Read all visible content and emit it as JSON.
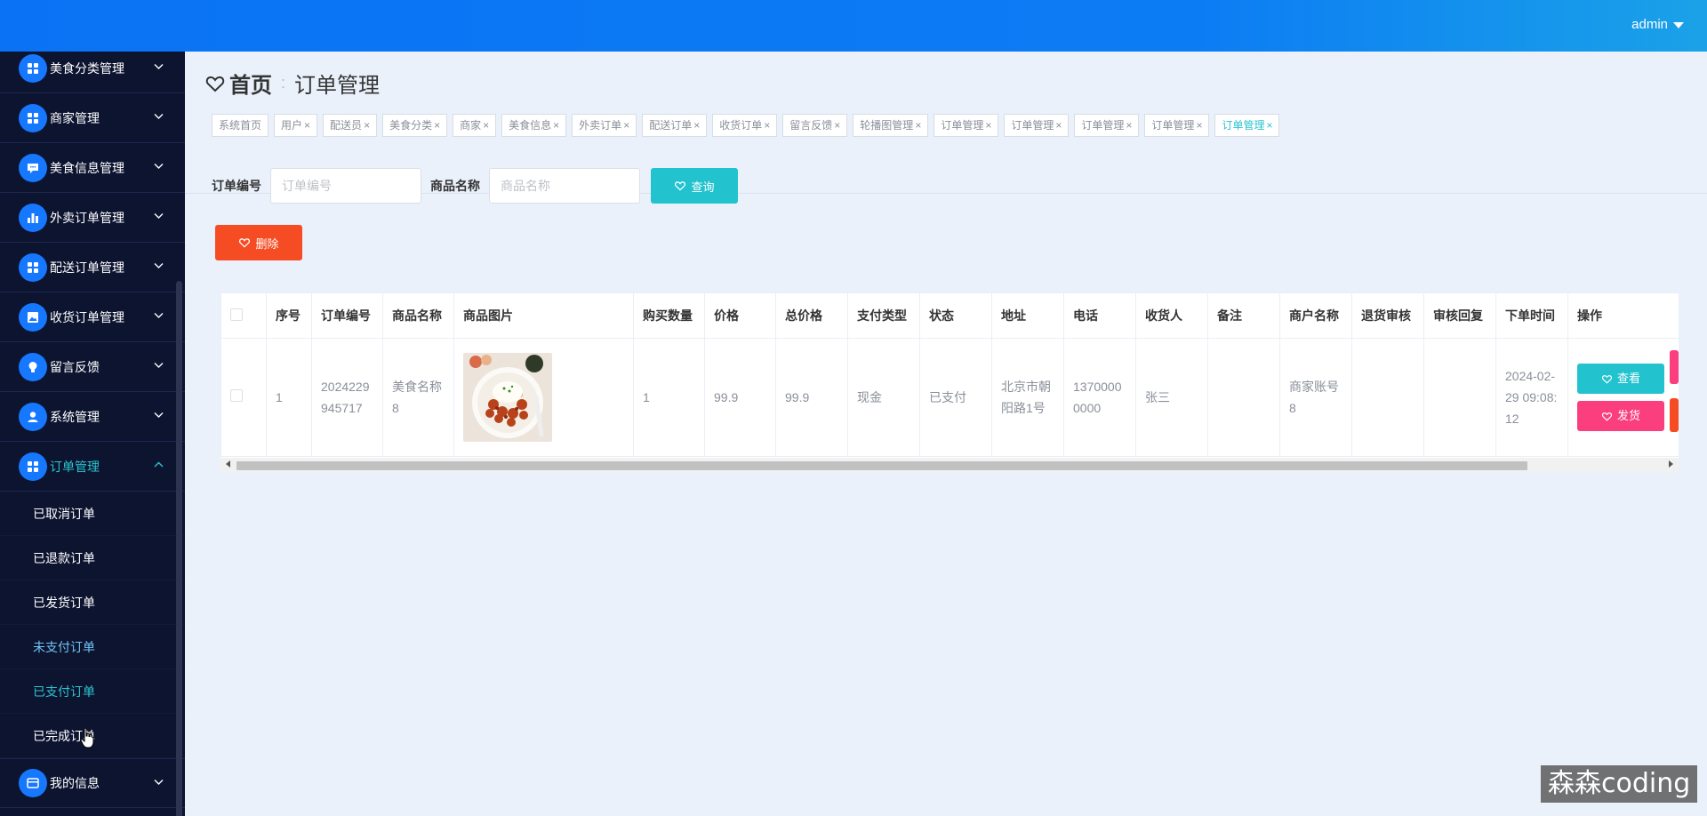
{
  "header": {
    "user": "admin"
  },
  "sidebar": {
    "items": [
      {
        "label": "美食分类管理",
        "icon": "grid-icon"
      },
      {
        "label": "商家管理",
        "icon": "grid-icon"
      },
      {
        "label": "美食信息管理",
        "icon": "chat-icon"
      },
      {
        "label": "外卖订单管理",
        "icon": "bar-chart-icon"
      },
      {
        "label": "配送订单管理",
        "icon": "grid-icon"
      },
      {
        "label": "收货订单管理",
        "icon": "picture-icon"
      },
      {
        "label": "留言反馈",
        "icon": "bulb-icon"
      },
      {
        "label": "系统管理",
        "icon": "user-icon"
      },
      {
        "label": "订单管理",
        "icon": "grid-icon",
        "expanded": true
      }
    ],
    "submenu": [
      "已取消订单",
      "已退款订单",
      "已发货订单",
      "未支付订单",
      "已支付订单",
      "已完成订单"
    ],
    "last_item": {
      "label": "我的信息",
      "icon": "card-icon"
    }
  },
  "breadcrumb": {
    "home": "首页",
    "separator": ":",
    "current": "订单管理"
  },
  "tags": [
    {
      "label": "系统首页",
      "closable": false
    },
    {
      "label": "用户",
      "closable": true
    },
    {
      "label": "配送员",
      "closable": true
    },
    {
      "label": "美食分类",
      "closable": true
    },
    {
      "label": "商家",
      "closable": true
    },
    {
      "label": "美食信息",
      "closable": true
    },
    {
      "label": "外卖订单",
      "closable": true
    },
    {
      "label": "配送订单",
      "closable": true
    },
    {
      "label": "收货订单",
      "closable": true
    },
    {
      "label": "留言反馈",
      "closable": true
    },
    {
      "label": "轮播图管理",
      "closable": true
    },
    {
      "label": "订单管理",
      "closable": true
    },
    {
      "label": "订单管理",
      "closable": true
    },
    {
      "label": "订单管理",
      "closable": true
    },
    {
      "label": "订单管理",
      "closable": true
    },
    {
      "label": "订单管理",
      "closable": true,
      "active": true
    }
  ],
  "search": {
    "order_no_label": "订单编号",
    "order_no_placeholder": "订单编号",
    "product_label": "商品名称",
    "product_placeholder": "商品名称",
    "query_button": "查询"
  },
  "actions": {
    "delete_button": "删除"
  },
  "table": {
    "columns": [
      "序号",
      "订单编号",
      "商品名称",
      "商品图片",
      "购买数量",
      "价格",
      "总价格",
      "支付类型",
      "状态",
      "地址",
      "电话",
      "收货人",
      "备注",
      "商户名称",
      "退货审核",
      "审核回复",
      "下单时间",
      "操作"
    ],
    "rows": [
      {
        "index": "1",
        "order_no": "2024229945717",
        "product": "美食名称8",
        "quantity": "1",
        "price": "99.9",
        "total": "99.9",
        "pay_type": "现金",
        "status": "已支付",
        "address": "北京市朝阳路1号",
        "phone": "13700000000",
        "receiver": "张三",
        "remark": "",
        "merchant": "商家账号8",
        "return_review": "",
        "review_reply": "",
        "order_time": "2024-02-29 09:08:12"
      }
    ],
    "row_actions": {
      "view": "查看",
      "ship": "发货"
    }
  },
  "watermark": "森森coding"
}
